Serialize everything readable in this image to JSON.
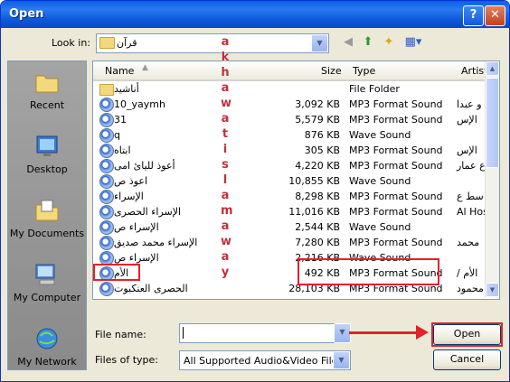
{
  "window": {
    "title": "Open",
    "help_label": "?",
    "close_label": "✕"
  },
  "toolbar": {
    "look_in_label": "Look in:",
    "look_in_value": "قرآن",
    "icons": [
      "back-icon",
      "up-folder-icon",
      "new-folder-icon",
      "views-menu-icon"
    ]
  },
  "places": [
    {
      "label": "Recent",
      "icon": "recent-folder-icon"
    },
    {
      "label": "Desktop",
      "icon": "desktop-icon"
    },
    {
      "label": "My Documents",
      "icon": "my-documents-icon"
    },
    {
      "label": "My Computer",
      "icon": "my-computer-icon"
    },
    {
      "label": "My Network",
      "icon": "my-network-icon"
    }
  ],
  "columns": {
    "name": "Name",
    "size": "Size",
    "type": "Type",
    "artist": "Artist"
  },
  "files": [
    {
      "name": "أناشيد",
      "size": "",
      "type": "File Folder",
      "artist": "",
      "folder": true
    },
    {
      "name": "10_yaymh",
      "size": "3,092 KB",
      "type": "MP3 Format Sound",
      "artist": "و عبدا"
    },
    {
      "name": "31",
      "size": "5,579 KB",
      "type": "MP3 Format Sound",
      "artist": "الإس"
    },
    {
      "name": "q",
      "size": "876 KB",
      "type": "Wave Sound",
      "artist": ""
    },
    {
      "name": "ابتاه",
      "size": "305 KB",
      "type": "MP3 Format Sound",
      "artist": "الإس"
    },
    {
      "name": "أعوذ لليائ امى",
      "size": "4,220 KB",
      "type": "MP3 Format Sound",
      "artist": "ع عمار"
    },
    {
      "name": "اعوذ ص",
      "size": "10,855 KB",
      "type": "Wave Sound",
      "artist": ""
    },
    {
      "name": "الإسراء",
      "size": "8,298 KB",
      "type": "MP3 Format Sound",
      "artist": "سط ع"
    },
    {
      "name": "الإسراء الحصرى",
      "size": "11,016 KB",
      "type": "MP3 Format Sound",
      "artist": "Al Hos"
    },
    {
      "name": "الإسراء ص",
      "size": "2,544 KB",
      "type": "Wave Sound",
      "artist": ""
    },
    {
      "name": "الإسراء محمد صديق",
      "size": "7,280 KB",
      "type": "MP3 Format Sound",
      "artist": "محمد"
    },
    {
      "name": "الإسراء ص",
      "size": "2,216 KB",
      "type": "Wave Sound",
      "artist": ""
    },
    {
      "name": "الأم",
      "size": "492 KB",
      "type": "MP3 Format Sound",
      "artist": "/ الأم"
    },
    {
      "name": "الحصرى العنكبوت",
      "size": "28,103 KB",
      "type": "MP3 Format Sound",
      "artist": "محمود"
    }
  ],
  "watermark": [
    "a",
    "k",
    "h",
    "a",
    "w",
    "a",
    "t",
    "i",
    "s",
    "l",
    "a",
    "m",
    "a",
    "w",
    "a",
    "y"
  ],
  "form": {
    "file_name_label": "File name:",
    "file_name_value": "",
    "files_of_type_label": "Files of type:",
    "files_of_type_value": "All Supported Audio&Video Files",
    "open_label": "Open",
    "cancel_label": "Cancel"
  },
  "accent_colors": {
    "title_bar": "#0a5fe0",
    "annotation": "#e2212a"
  }
}
